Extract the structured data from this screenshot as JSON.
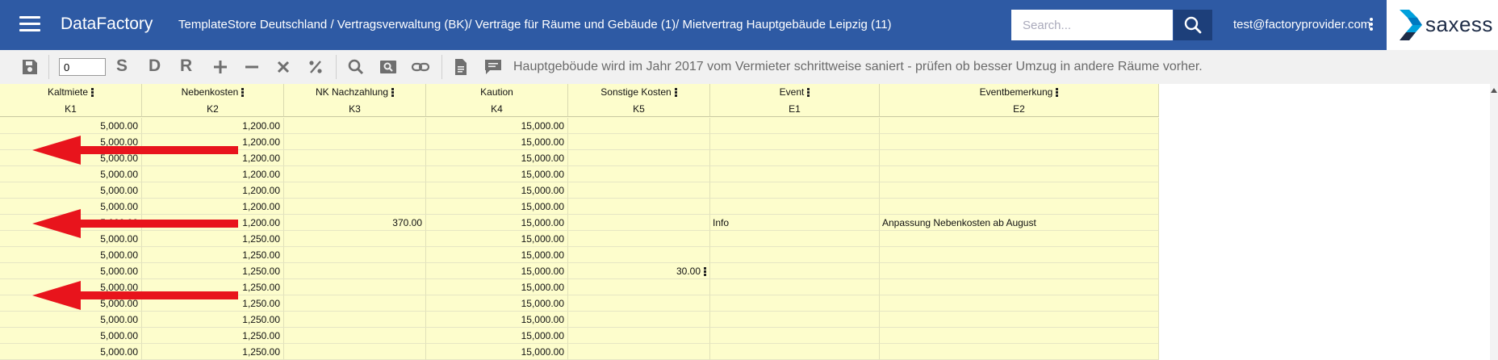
{
  "app": {
    "title": "DataFactory"
  },
  "breadcrumb": "TemplateStore Deutschland / Vertragsverwaltung (BK)/ Verträge für Räume und Gebäude (1)/ Mietvertrag Hauptgebäude Leipzig (11)",
  "search": {
    "placeholder": "Search...",
    "value": ""
  },
  "user": {
    "email": "test@factoryprovider.com"
  },
  "logo": {
    "text": "saxess"
  },
  "toolbar": {
    "row_input": "0",
    "letters": [
      "S",
      "D",
      "R"
    ],
    "note": "Hauptgeböude wird im Jahr 2017 vom Vermieter schrittweise saniert - prüfen ob besser Umzug in andere Räume vorher."
  },
  "icons": {
    "menu": "hamburger-icon",
    "search": "search-icon",
    "more": "kebab-icon",
    "save": "save-icon",
    "add": "plus-icon",
    "remove": "minus-icon",
    "clear": "close-icon",
    "percent": "percent-icon",
    "zoom": "magnifier-icon",
    "image-search": "image-search-icon",
    "link": "link-icon",
    "document": "document-icon",
    "comment": "comment-icon"
  },
  "colors": {
    "header": "#2e5aa4",
    "grid_bg": "#fdfdcc",
    "arrow": "#e8141c"
  },
  "grid": {
    "columns": [
      {
        "label": "Kaltmiete",
        "code": "K1",
        "menu": true
      },
      {
        "label": "Nebenkosten",
        "code": "K2",
        "menu": true
      },
      {
        "label": "NK Nachzahlung",
        "code": "K3",
        "menu": true
      },
      {
        "label": "Kaution",
        "code": "K4",
        "menu": false
      },
      {
        "label": "Sonstige Kosten",
        "code": "K5",
        "menu": true
      },
      {
        "label": "Event",
        "code": "E1",
        "menu": true
      },
      {
        "label": "Eventbemerkung",
        "code": "E2",
        "menu": true
      }
    ],
    "rows": [
      [
        "5,000.00",
        "1,200.00",
        "",
        "15,000.00",
        "",
        "",
        ""
      ],
      [
        "5,000.00",
        "1,200.00",
        "",
        "15,000.00",
        "",
        "",
        ""
      ],
      [
        "5,000.00",
        "1,200.00",
        "",
        "15,000.00",
        "",
        "",
        ""
      ],
      [
        "5,000.00",
        "1,200.00",
        "",
        "15,000.00",
        "",
        "",
        ""
      ],
      [
        "5,000.00",
        "1,200.00",
        "",
        "15,000.00",
        "",
        "",
        ""
      ],
      [
        "5,000.00",
        "1,200.00",
        "",
        "15,000.00",
        "",
        "",
        ""
      ],
      [
        "5,000.00",
        "1,200.00",
        "370.00",
        "15,000.00",
        "",
        "Info",
        "Anpassung Nebenkosten ab August"
      ],
      [
        "5,000.00",
        "1,250.00",
        "",
        "15,000.00",
        "",
        "",
        ""
      ],
      [
        "5,000.00",
        "1,250.00",
        "",
        "15,000.00",
        "",
        "",
        ""
      ],
      [
        "5,000.00",
        "1,250.00",
        "",
        "15,000.00",
        "30.00",
        "",
        ""
      ],
      [
        "5,000.00",
        "1,250.00",
        "",
        "15,000.00",
        "",
        "",
        ""
      ],
      [
        "5,000.00",
        "1,250.00",
        "",
        "15,000.00",
        "",
        "",
        ""
      ],
      [
        "5,000.00",
        "1,250.00",
        "",
        "15,000.00",
        "",
        "",
        ""
      ],
      [
        "5,000.00",
        "1,250.00",
        "",
        "15,000.00",
        "",
        "",
        ""
      ],
      [
        "5,000.00",
        "1,250.00",
        "",
        "15,000.00",
        "",
        "",
        ""
      ]
    ]
  }
}
